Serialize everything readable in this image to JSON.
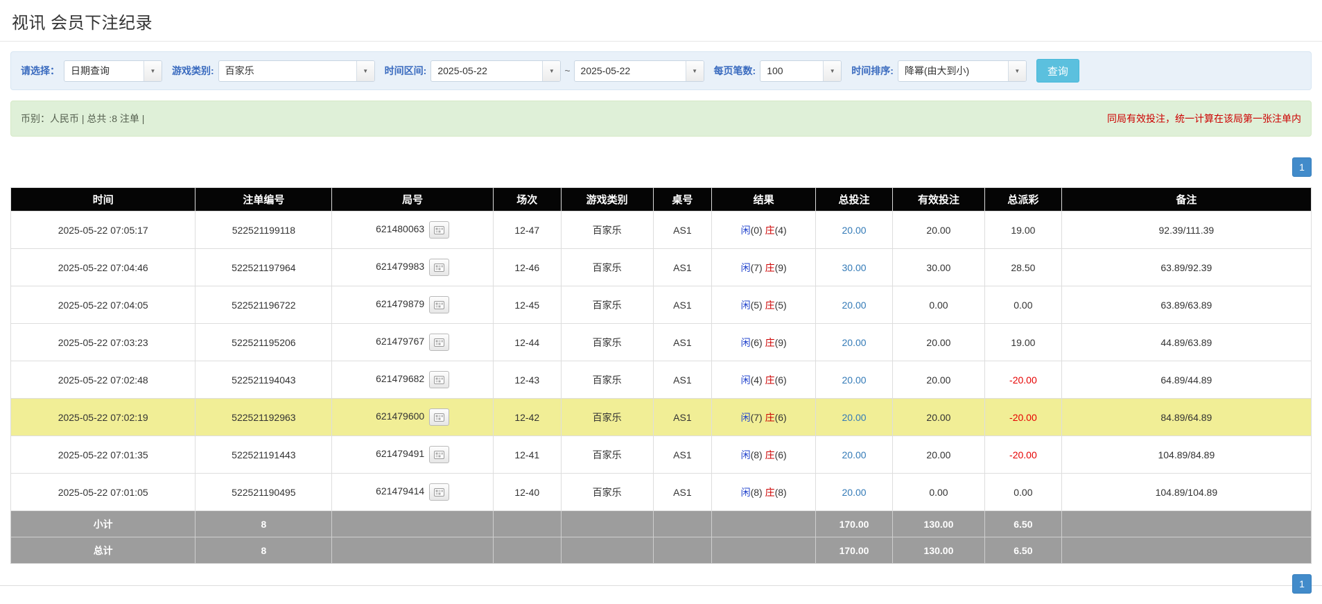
{
  "page": {
    "title": "视讯 会员下注纪录"
  },
  "icons": {
    "chevron_down": "▼"
  },
  "colors": {
    "header_bg": "#050505",
    "filter_bg": "#e9f1f9",
    "label_blue": "#3a6bbf",
    "search_btn": "#5bc0de",
    "summary_bg": "#dff0d8",
    "notice_red": "#cc0000",
    "page_btn": "#428bca",
    "highlight_row": "#f1ee96",
    "player_blue": "#2244cc",
    "banker_red": "#cc0000",
    "link_blue": "#337ab7",
    "negative_red": "#e60000",
    "footer_bg": "#9d9d9d"
  },
  "filters": {
    "select_label": "请选择：",
    "select_value": "日期查询",
    "game_label": "游戏类别:",
    "game_value": "百家乐",
    "range_label": "时间区间:",
    "date_from": "2025-05-22",
    "range_separator": "~",
    "date_to": "2025-05-22",
    "page_size_label": "每页笔数:",
    "page_size_value": "100",
    "sort_label": "时间排序:",
    "sort_value": "降幂(由大到小)",
    "search_label": "查询"
  },
  "summary": {
    "currency_info": "币别：人民币 | 总共 :8 注单 |",
    "notice": "同局有效投注，统一计算在该局第一张注单内"
  },
  "pagination": {
    "current_page": "1"
  },
  "table": {
    "headers": [
      "时间",
      "注单编号",
      "局号",
      "场次",
      "游戏类别",
      "桌号",
      "结果",
      "总投注",
      "有效投注",
      "总派彩",
      "备注"
    ],
    "rows": [
      {
        "time": "2025-05-22 07:05:17",
        "bet_id": "522521199118",
        "round_id": "621480063",
        "session": "12-47",
        "game_type": "百家乐",
        "table_no": "AS1",
        "result_player": "闲",
        "result_player_score": "(0)",
        "result_banker": "庄",
        "result_banker_score": "(4)",
        "total_bet": "20.00",
        "valid_bet": "20.00",
        "payout": "19.00",
        "remark": "92.39/111.39",
        "highlight": false
      },
      {
        "time": "2025-05-22 07:04:46",
        "bet_id": "522521197964",
        "round_id": "621479983",
        "session": "12-46",
        "game_type": "百家乐",
        "table_no": "AS1",
        "result_player": "闲",
        "result_player_score": "(7)",
        "result_banker": "庄",
        "result_banker_score": "(9)",
        "total_bet": "30.00",
        "valid_bet": "30.00",
        "payout": "28.50",
        "remark": "63.89/92.39",
        "highlight": false
      },
      {
        "time": "2025-05-22 07:04:05",
        "bet_id": "522521196722",
        "round_id": "621479879",
        "session": "12-45",
        "game_type": "百家乐",
        "table_no": "AS1",
        "result_player": "闲",
        "result_player_score": "(5)",
        "result_banker": "庄",
        "result_banker_score": "(5)",
        "total_bet": "20.00",
        "valid_bet": "0.00",
        "payout": "0.00",
        "remark": "63.89/63.89",
        "highlight": false
      },
      {
        "time": "2025-05-22 07:03:23",
        "bet_id": "522521195206",
        "round_id": "621479767",
        "session": "12-44",
        "game_type": "百家乐",
        "table_no": "AS1",
        "result_player": "闲",
        "result_player_score": "(6)",
        "result_banker": "庄",
        "result_banker_score": "(9)",
        "total_bet": "20.00",
        "valid_bet": "20.00",
        "payout": "19.00",
        "remark": "44.89/63.89",
        "highlight": false
      },
      {
        "time": "2025-05-22 07:02:48",
        "bet_id": "522521194043",
        "round_id": "621479682",
        "session": "12-43",
        "game_type": "百家乐",
        "table_no": "AS1",
        "result_player": "闲",
        "result_player_score": "(4)",
        "result_banker": "庄",
        "result_banker_score": "(6)",
        "total_bet": "20.00",
        "valid_bet": "20.00",
        "payout": "-20.00",
        "remark": "64.89/44.89",
        "highlight": false
      },
      {
        "time": "2025-05-22 07:02:19",
        "bet_id": "522521192963",
        "round_id": "621479600",
        "session": "12-42",
        "game_type": "百家乐",
        "table_no": "AS1",
        "result_player": "闲",
        "result_player_score": "(7)",
        "result_banker": "庄",
        "result_banker_score": "(6)",
        "total_bet": "20.00",
        "valid_bet": "20.00",
        "payout": "-20.00",
        "remark": "84.89/64.89",
        "highlight": true
      },
      {
        "time": "2025-05-22 07:01:35",
        "bet_id": "522521191443",
        "round_id": "621479491",
        "session": "12-41",
        "game_type": "百家乐",
        "table_no": "AS1",
        "result_player": "闲",
        "result_player_score": "(8)",
        "result_banker": "庄",
        "result_banker_score": "(6)",
        "total_bet": "20.00",
        "valid_bet": "20.00",
        "payout": "-20.00",
        "remark": "104.89/84.89",
        "highlight": false
      },
      {
        "time": "2025-05-22 07:01:05",
        "bet_id": "522521190495",
        "round_id": "621479414",
        "session": "12-40",
        "game_type": "百家乐",
        "table_no": "AS1",
        "result_player": "闲",
        "result_player_score": "(8)",
        "result_banker": "庄",
        "result_banker_score": "(8)",
        "total_bet": "20.00",
        "valid_bet": "0.00",
        "payout": "0.00",
        "remark": "104.89/104.89",
        "highlight": false
      }
    ],
    "footer_rows": [
      {
        "label": "小计",
        "count": "8",
        "round_id": "",
        "session": "",
        "game_type": "",
        "table_no": "",
        "result": "",
        "total_bet": "170.00",
        "valid_bet": "130.00",
        "payout": "6.50",
        "remark": ""
      },
      {
        "label": "总计",
        "count": "8",
        "round_id": "",
        "session": "",
        "game_type": "",
        "table_no": "",
        "result": "",
        "total_bet": "170.00",
        "valid_bet": "130.00",
        "payout": "6.50",
        "remark": ""
      }
    ]
  }
}
